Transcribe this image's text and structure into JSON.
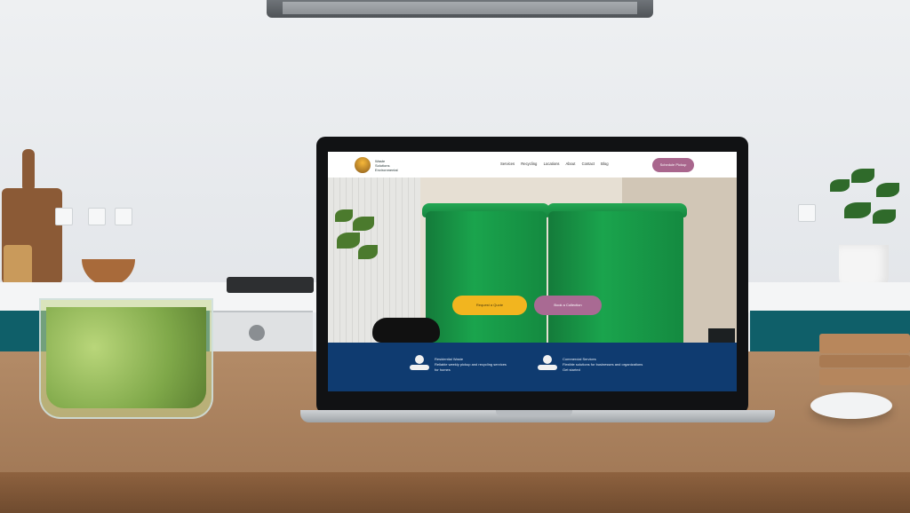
{
  "website": {
    "header": {
      "logo_text_line1": "Waste",
      "logo_text_line2": "Solutions",
      "logo_text_line3": "Environmental",
      "nav_items": [
        "Services",
        "Recycling",
        "Locations",
        "About",
        "Contact",
        "Blog"
      ],
      "cta_label": "Schedule Pickup"
    },
    "hero": {
      "primary_button": "Request a Quote",
      "secondary_button": "Book a Collection"
    },
    "services": [
      {
        "icon": "recycling-person-icon",
        "title": "Residential Waste",
        "description": "Reliable weekly pickup and recycling services",
        "detail": "for homes"
      },
      {
        "icon": "community-icon",
        "title": "Commercial Services",
        "description": "Flexible solutions for businesses and organizations",
        "detail": "Get started"
      }
    ]
  }
}
